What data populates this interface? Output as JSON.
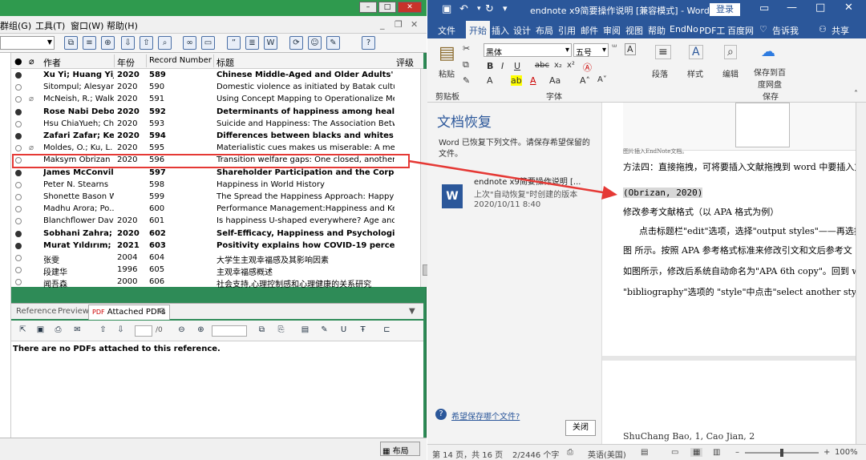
{
  "endnote": {
    "menu": [
      "群组(G)",
      "工具(T)",
      "窗口(W)",
      "帮助(H)"
    ],
    "columns": {
      "author": "作者",
      "year": "年份",
      "record": "Record Number",
      "title": "标题",
      "rating": "评级"
    },
    "rows": [
      {
        "author": "Xu Yi; Huang Yijie",
        "year": "2020",
        "rec": "589",
        "title": "Chinese Middle-Aged and Older Adults' Interne...",
        "unread": true,
        "clip": false
      },
      {
        "author": "Sitompul; Alesyan...",
        "year": "2020",
        "rec": "590",
        "title": "Domestic violence as initiated by Batak culture in ...",
        "unread": false,
        "clip": false
      },
      {
        "author": "McNeish, R.; Walk...",
        "year": "2020",
        "rec": "591",
        "title": "Using Concept Mapping to Operationalize Mental...",
        "unread": false,
        "clip": true
      },
      {
        "author": "Rose Nabi Debor...",
        "year": "2020",
        "rec": "592",
        "title": "Determinants of happiness among healthcare p...",
        "unread": true,
        "clip": false
      },
      {
        "author": "Hsu ChiaYueh; Ch...",
        "year": "2020",
        "rec": "593",
        "title": "Suicide and Happiness: The Association Between ...",
        "unread": false,
        "clip": false
      },
      {
        "author": "Zafari Zafar; Key...",
        "year": "2020",
        "rec": "594",
        "title": "Differences between blacks and whites in well...",
        "unread": true,
        "clip": false
      },
      {
        "author": "Moldes, O.; Ku, L. S.",
        "year": "2020",
        "rec": "595",
        "title": "Materialistic cues makes us miserable: A meta-an...",
        "unread": false,
        "clip": true
      },
      {
        "author": "Maksym Obrizan",
        "year": "2020",
        "rec": "596",
        "title": "Transition welfare gaps: One closed, another to fo...",
        "unread": false,
        "clip": false,
        "selected": true
      },
      {
        "author": "James McConvill",
        "year": "",
        "rec": "597",
        "title": "Shareholder Participation and the Corporation:...",
        "unread": true,
        "clip": false
      },
      {
        "author": "Peter N. Stearns",
        "year": "",
        "rec": "598",
        "title": "Happiness in World History",
        "unread": false,
        "clip": false
      },
      {
        "author": "Shonette Bason W...",
        "year": "",
        "rec": "599",
        "title": "The Spread the Happiness Approach: Happy Teac...",
        "unread": false,
        "clip": false
      },
      {
        "author": "Madhu Arora; Po...",
        "year": "",
        "rec": "600",
        "title": "Performance Management:Happiness and Keepin...",
        "unread": false,
        "clip": false
      },
      {
        "author": "Blanchflower Davi...",
        "year": "2020",
        "rec": "601",
        "title": "Is happiness U-shaped everywhere? Age and subj...",
        "unread": false,
        "clip": false
      },
      {
        "author": "Sobhani Zahra; A...",
        "year": "2020",
        "rec": "602",
        "title": "Self-Efficacy, Happiness and Psychological Well...",
        "unread": true,
        "clip": false
      },
      {
        "author": "Murat Yıldırım; A...",
        "year": "2021",
        "rec": "603",
        "title": "Positivity explains how COVID-19 perceived ris...",
        "unread": true,
        "clip": false
      },
      {
        "author": "张雯",
        "year": "2004",
        "rec": "604",
        "title": "大学生主观幸福感及其影响因素",
        "unread": false,
        "clip": false
      },
      {
        "author": "段建华",
        "year": "1996",
        "rec": "605",
        "title": "主观幸福感概述",
        "unread": false,
        "clip": false
      },
      {
        "author": "闻吾森",
        "year": "2000",
        "rec": "606",
        "title": "社会支持,心理控制感和心理健康的关系研究",
        "unread": false,
        "clip": false
      }
    ],
    "tabs": [
      "Reference",
      "Preview",
      "Attached PDFs"
    ],
    "page_counter": "/0",
    "no_pdf_message": "There are no PDFs attached to this reference.",
    "layout_label": "布局"
  },
  "word": {
    "title": "endnote x9简要操作说明 [兼容模式] - Word",
    "login": "登录",
    "tabs": [
      "文件",
      "开始",
      "插入",
      "设计",
      "布局",
      "引用",
      "邮件",
      "审阅",
      "视图",
      "帮助",
      "EndNo",
      "PDF工",
      "百度网"
    ],
    "tell_me": "告诉我",
    "share": "共享",
    "ribbon": {
      "paste": "粘贴",
      "clipboard": "剪贴板",
      "font_name": "黑体",
      "font_size": "五号",
      "font_group": "字体",
      "paragraph": "段落",
      "styles": "样式",
      "editing": "编辑",
      "save_baidu": "保存到百度网盘",
      "save_group": "保存"
    },
    "recovery": {
      "title": "文档恢复",
      "desc": "Word 已恢复下列文件。请保存希望保留的文件。",
      "file_name": "endnote x9简要操作说明 [...",
      "file_sub": "上次\"自动恢复\"时创建的版本",
      "file_date": "2020/10/11 8:40",
      "help_link": "希望保存哪个文件?",
      "close": "关闭"
    },
    "doc": {
      "caption": "图片插入EndNote文档。",
      "line1": "方法四：直接拖拽，可将要插入文献拖拽到 word 中要插入文",
      "citation": "(Obrizan, 2020)",
      "line2": "修改参考文献格式（以 APA 格式为例）",
      "line3": "点击标题栏\"edit\"选项，选择\"output styles\"——再选择\"",
      "line4": "图  所示。按照 APA 参考格式标准来修改引文和文后参考文",
      "line5": "如图所示，修改后系统自动命名为\"APA 6th copy\"。回到 w",
      "line6": "\"bibliography\"选项的 \"style\"中点击\"select another style\"中选",
      "line7": "ShuChang Bao, 1, Cao Jian, 2"
    },
    "status": {
      "page": "第 14 页，共 16 页",
      "words": "2/2446 个字",
      "lang": "英语(美国)",
      "zoom": "100%"
    }
  }
}
